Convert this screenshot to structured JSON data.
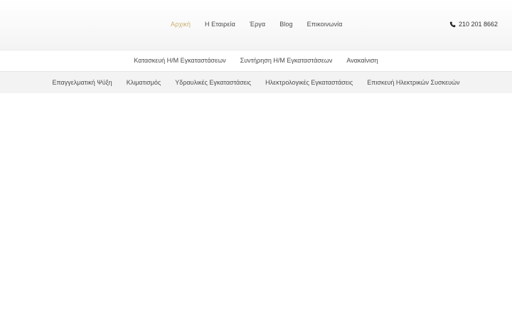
{
  "header": {
    "nav": [
      {
        "label": "Αρχική",
        "active": true
      },
      {
        "label": "Η Εταιρεία",
        "active": false
      },
      {
        "label": "Έργα",
        "active": false
      },
      {
        "label": "Blog",
        "active": false
      },
      {
        "label": "Επικοινωνία",
        "active": false
      }
    ],
    "phone": {
      "icon": "phone-icon",
      "number": "210 201 8662"
    },
    "active_color": "#c9b06e"
  },
  "services_row_1": [
    {
      "label": "Κατασκευή Η/Μ Εγκαταστάσεων"
    },
    {
      "label": "Συντήρηση Η/Μ Εγκαταστάσεων"
    },
    {
      "label": "Ανακαίνιση"
    }
  ],
  "services_row_2": [
    {
      "label": "Επαγγελματική Ψύξη"
    },
    {
      "label": "Κλιματισμός"
    },
    {
      "label": "Υδραυλικές Εγκαταστάσεις"
    },
    {
      "label": "Ηλεκτρολογικές Εγκαταστάσεις"
    },
    {
      "label": "Επισκευή Ηλεκτρικών Συσκευών"
    }
  ]
}
